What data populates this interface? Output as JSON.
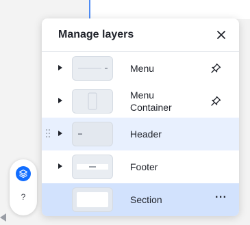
{
  "panel": {
    "title": "Manage layers",
    "close_icon": "close-icon"
  },
  "layers": [
    {
      "label": "Menu",
      "state": "normal",
      "expandable": true,
      "action_icon": "pin-icon"
    },
    {
      "label_line1": "Menu",
      "label_line2": "Container",
      "state": "normal",
      "expandable": true,
      "action_icon": "pin-icon"
    },
    {
      "label": "Header",
      "state": "hover",
      "expandable": true,
      "action_icon": "drag-handle-icon"
    },
    {
      "label": "Footer",
      "state": "normal",
      "expandable": true
    },
    {
      "label": "Section",
      "state": "selected",
      "expandable": false,
      "action_icon": "more-options-icon",
      "more_text": "···"
    }
  ],
  "side_toolbar": {
    "layers_icon": "layers-icon",
    "help_text": "?"
  },
  "colors": {
    "accent": "#116dff",
    "hover_row": "#e8f0fe",
    "selected_row": "#d2e2fd"
  }
}
